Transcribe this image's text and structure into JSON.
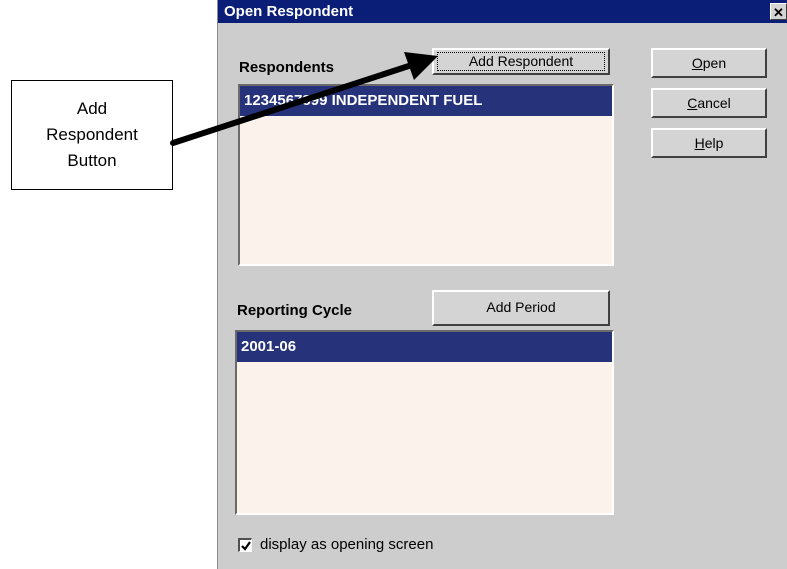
{
  "dialog": {
    "title": "Open Respondent",
    "close_symbol": "✕",
    "respondents_label": "Respondents",
    "add_respondent_label": "Add Respondent",
    "respondents": [
      "1234567899 INDEPENDENT FUEL"
    ],
    "reporting_cycle_label": "Reporting Cycle",
    "add_period_label": "Add Period",
    "periods": [
      "2001-06"
    ],
    "buttons": {
      "open": {
        "mnemonic": "O",
        "rest": "pen"
      },
      "cancel": {
        "mnemonic": "C",
        "rest": "ancel"
      },
      "help": {
        "mnemonic": "H",
        "rest": "elp"
      }
    },
    "checkbox_label": "display as opening screen",
    "checkbox_checked": true
  },
  "callout": {
    "line1": "Add",
    "line2": "Respondent",
    "line3": "Button"
  },
  "colors": {
    "titlebar": "#0a1e78",
    "selection": "#26337a",
    "list_background": "#fbf2ec",
    "dialog_background": "#cdcdcd"
  },
  "icons": {
    "close": "close-icon",
    "check": "checkmark-icon",
    "arrow": "arrow-icon"
  }
}
